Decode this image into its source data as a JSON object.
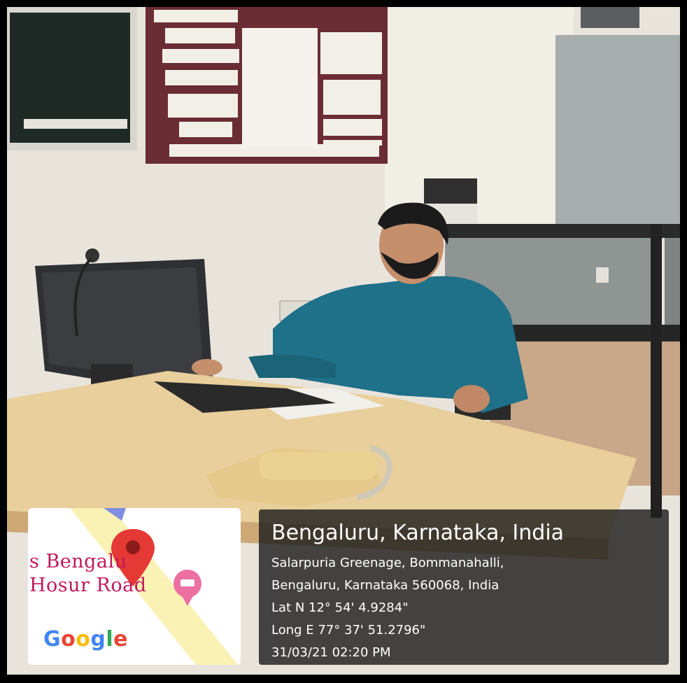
{
  "map": {
    "place_line1": "s Bengalu",
    "place_line2": "Hosur Road",
    "brand": "Google",
    "pin_icon": "location-pin-icon",
    "marker_icon": "hotel-marker-icon"
  },
  "location": {
    "city": "Bengaluru, Karnataka, India",
    "address_line1": "Salarpuria Greenage, Bommanahalli,",
    "address_line2": "Bengaluru, Karnataka 560068, India",
    "lat": "Lat N 12° 54' 4.9284\"",
    "long": "Long E 77° 37' 51.2796\"",
    "datetime": "31/03/21 02:20 PM"
  },
  "colors": {
    "shirt": "#1f7089",
    "desk": "#e8cf9b",
    "pin": "#e53935"
  }
}
